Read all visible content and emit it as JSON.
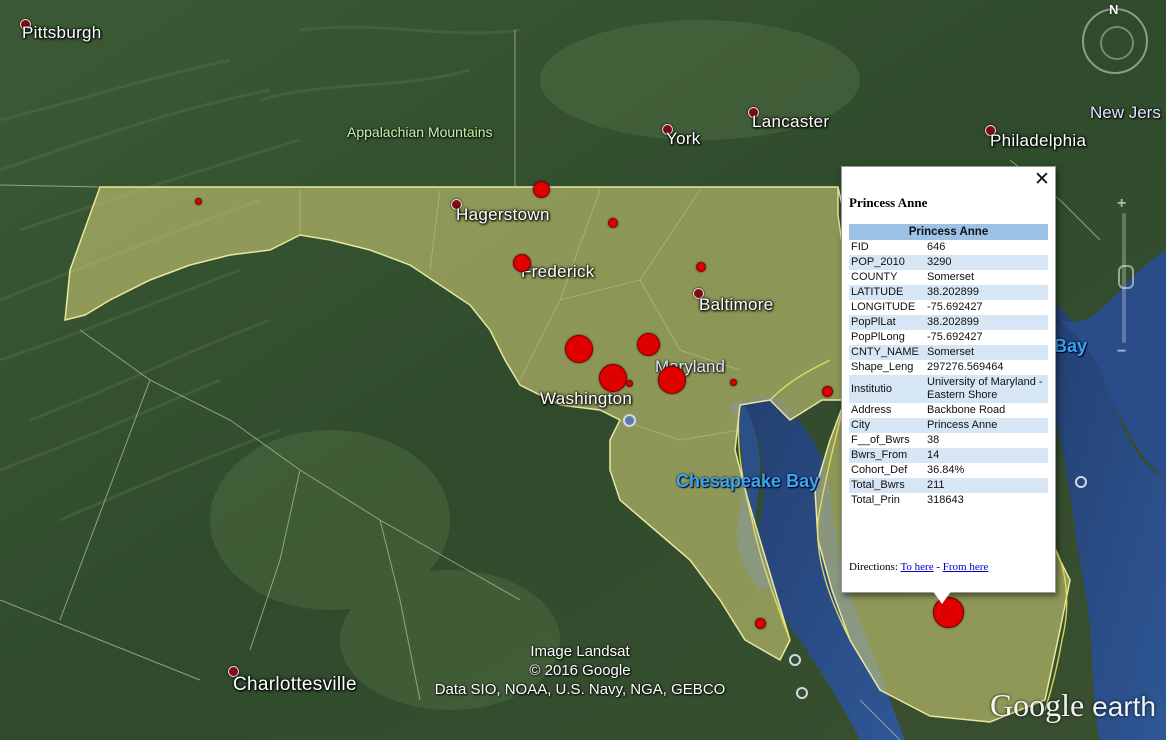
{
  "map": {
    "cities": [
      {
        "name": "Pittsburgh",
        "id": "pittsburgh"
      },
      {
        "name": "York",
        "id": "york"
      },
      {
        "name": "Lancaster",
        "id": "lancaster"
      },
      {
        "name": "Philadelphia",
        "id": "philadelphia"
      },
      {
        "name": "Hagerstown",
        "id": "hagerstown"
      },
      {
        "name": "Frederick",
        "id": "frederick"
      },
      {
        "name": "Baltimore",
        "id": "baltimore"
      },
      {
        "name": "Washington",
        "id": "washington"
      },
      {
        "name": "Charlottesville",
        "id": "charlottesville"
      }
    ],
    "region_label": "Appalachian Mountains",
    "state_labels": {
      "maryland": "Maryland",
      "new_jersey": "New Jers"
    },
    "water_labels": {
      "chesapeake": "Chesapeake Bay",
      "bay_partial": "Bay"
    },
    "colors": {
      "state_fill": "#d8d67a",
      "marker": "#e00000",
      "table_header": "#9cc2e5",
      "table_alt_row": "#d7e6f5",
      "water": "#2b4f86"
    },
    "credits": {
      "line1": "Image Landsat",
      "line2": "© 2016 Google",
      "line3": "Data SIO, NOAA, U.S. Navy, NGA, GEBCO"
    },
    "logo": {
      "google": "Google",
      "earth": "earth"
    },
    "compass_north": "N"
  },
  "balloon": {
    "title": "Princess Anne",
    "table_header": "Princess Anne",
    "rows": [
      {
        "key": "FID",
        "value": "646"
      },
      {
        "key": "POP_2010",
        "value": "3290"
      },
      {
        "key": "COUNTY",
        "value": "Somerset"
      },
      {
        "key": "LATITUDE",
        "value": "38.202899"
      },
      {
        "key": "LONGITUDE",
        "value": "-75.692427"
      },
      {
        "key": "PopPlLat",
        "value": "38.202899"
      },
      {
        "key": "PopPlLong",
        "value": "-75.692427"
      },
      {
        "key": "CNTY_NAME",
        "value": "Somerset"
      },
      {
        "key": "Shape_Leng",
        "value": "297276.569464"
      },
      {
        "key": "Institutio",
        "value": "University of Maryland - Eastern Shore"
      },
      {
        "key": "Address",
        "value": "Backbone Road"
      },
      {
        "key": "City",
        "value": "Princess Anne"
      },
      {
        "key": "F__of_Bwrs",
        "value": "38"
      },
      {
        "key": "Bwrs_From",
        "value": "14"
      },
      {
        "key": "Cohort_Def",
        "value": "36.84%"
      },
      {
        "key": "Total_Bwrs",
        "value": "211"
      },
      {
        "key": "Total_Prin",
        "value": "318643"
      }
    ],
    "directions_label": "Directions:",
    "to_here": "To here",
    "separator": "-",
    "from_here": "From here",
    "close_icon": "close-icon"
  }
}
